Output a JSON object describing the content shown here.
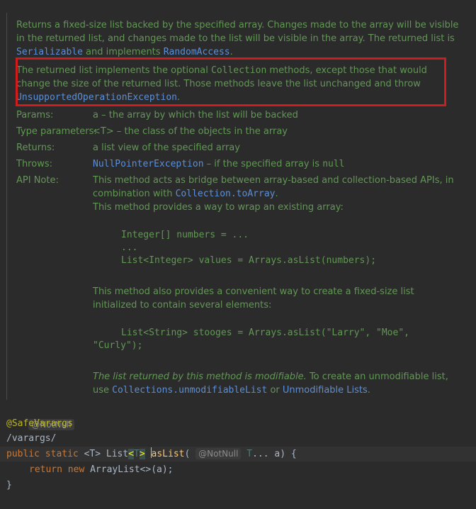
{
  "doc": {
    "p1": {
      "text_a": "Returns a fixed-size list backed by the specified array. Changes made to the array will be visible in the returned list, and changes made to the list will be visible in the array. The returned list is ",
      "link_serializable": "Serializable",
      "text_b": " and implements ",
      "link_random_access": "RandomAccess",
      "text_c": "."
    },
    "p2": {
      "text_a": "The returned list implements the optional ",
      "code_collection": "Collection",
      "text_b": " methods, except those that would change the size of the returned list. Those methods leave the list unchanged and throw ",
      "link_exception": "UnsupportedOperationException",
      "text_c": "."
    },
    "params": {
      "label": "Params:",
      "value": "a – the array by which the list will be backed"
    },
    "type_params": {
      "label": "Type parameters:",
      "value": "<T> – the class of the objects in the array"
    },
    "returns": {
      "label": "Returns:",
      "value": "a list view of the specified array"
    },
    "throws": {
      "label": "Throws:",
      "link": "NullPointerException",
      "text": " – if the specified array is ",
      "code_null": "null"
    },
    "api_note": {
      "label": "API Note:",
      "line1_a": "This method acts as bridge between array-based and collection-based APIs, in combination with ",
      "line1_link": "Collection.toArray",
      "line1_b": ".",
      "line2": "This method provides a way to wrap an existing array:",
      "example1": [
        "Integer[] numbers = ...",
        "...",
        "List<Integer> values = Arrays.asList(numbers);"
      ],
      "line3": "This method also provides a convenient way to create a fixed-size list initialized to contain several elements:",
      "example2_line1": "List<String> stooges = Arrays.asList(\"Larry\", \"Moe\",",
      "example2_line2": "\"Curly\");",
      "line4_italic": "The list returned by this method is modifiable.",
      "line4_a": " To create an unmodifiable list, use ",
      "line4_link1": "Collections.unmodifiableList",
      "line4_b": " or ",
      "line4_link2": "Unmodifiable Lists",
      "line4_c": "."
    }
  },
  "code": {
    "inlay_notnull": "@NotNull",
    "annotation": "@SafeVarargs",
    "comment": "/varargs/",
    "sig": {
      "public": "public",
      "static": "static",
      "tparam": "<T>",
      "list": "List",
      "lt": "<",
      "t": "T",
      "gt": ">",
      "name": "asList",
      "open": "(",
      "inlay_param": "@NotNull",
      "param_type": "T",
      "rest": "... a) {"
    },
    "body": {
      "return": "return",
      "new": "new",
      "rest": "ArrayList<>(a);"
    },
    "close": "}"
  },
  "colors": {
    "doc_text": "#629755",
    "link": "#5c8fd6",
    "highlight_border": "#d01c1c",
    "keyword": "#cc7832",
    "annotation": "#bbb529",
    "method": "#ffc66d",
    "background": "#2b2b2b"
  }
}
